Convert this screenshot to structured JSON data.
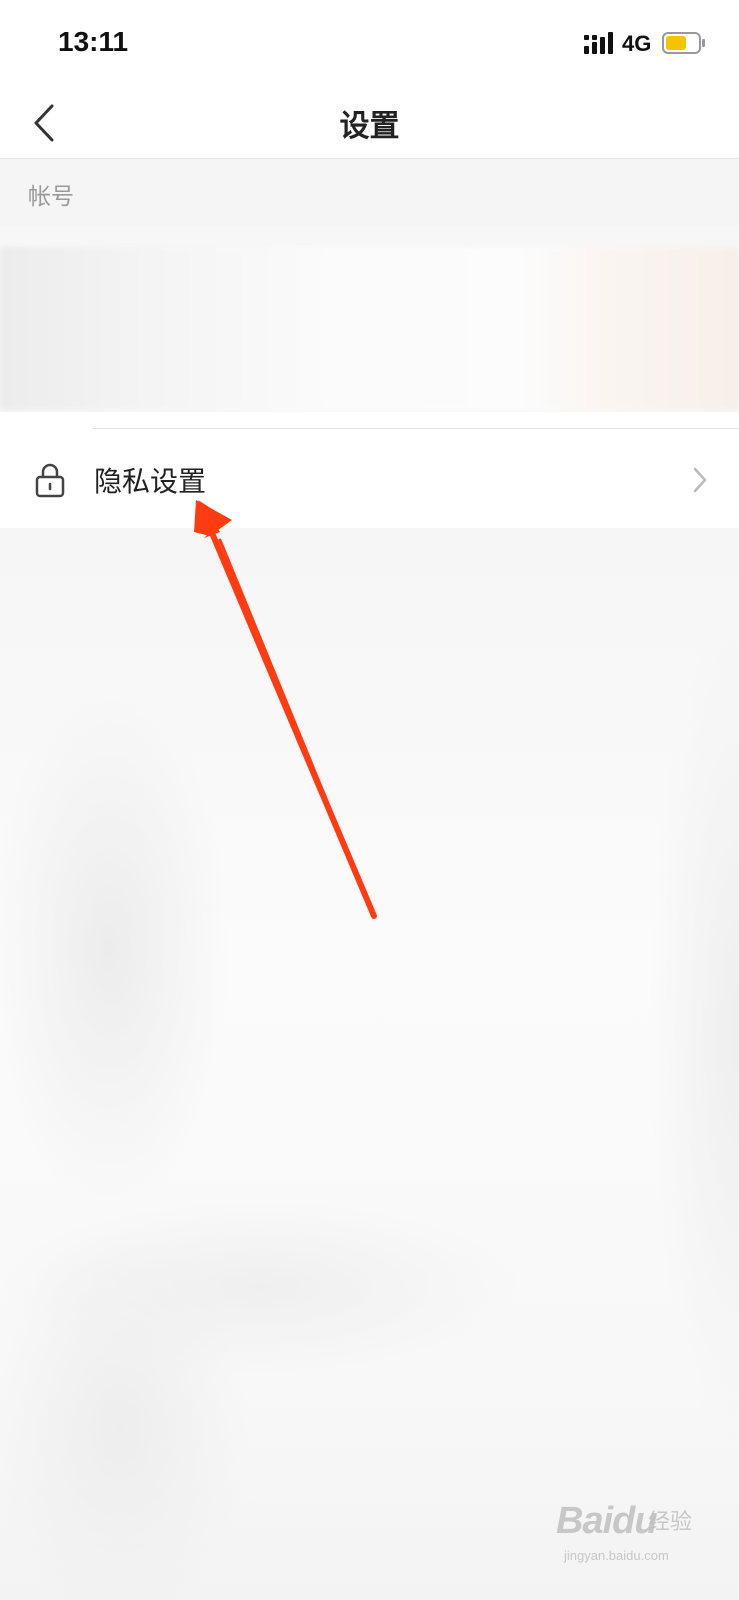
{
  "status_bar": {
    "time": "13:11",
    "network": "4G",
    "battery_color": "#f5c400",
    "icons": [
      "signal-icon",
      "battery-icon"
    ]
  },
  "header": {
    "title": "设置",
    "back_icon": "chevron-left-icon"
  },
  "account_section": {
    "label": "帐号"
  },
  "menu": {
    "privacy": {
      "label": "隐私设置",
      "icon": "lock-icon",
      "trailing_icon": "chevron-right-icon"
    }
  },
  "annotation": {
    "arrow_color": "#ff3b12"
  },
  "watermark": {
    "brand": "Baidu",
    "text": "经验",
    "url": "jingyan.baidu.com"
  }
}
